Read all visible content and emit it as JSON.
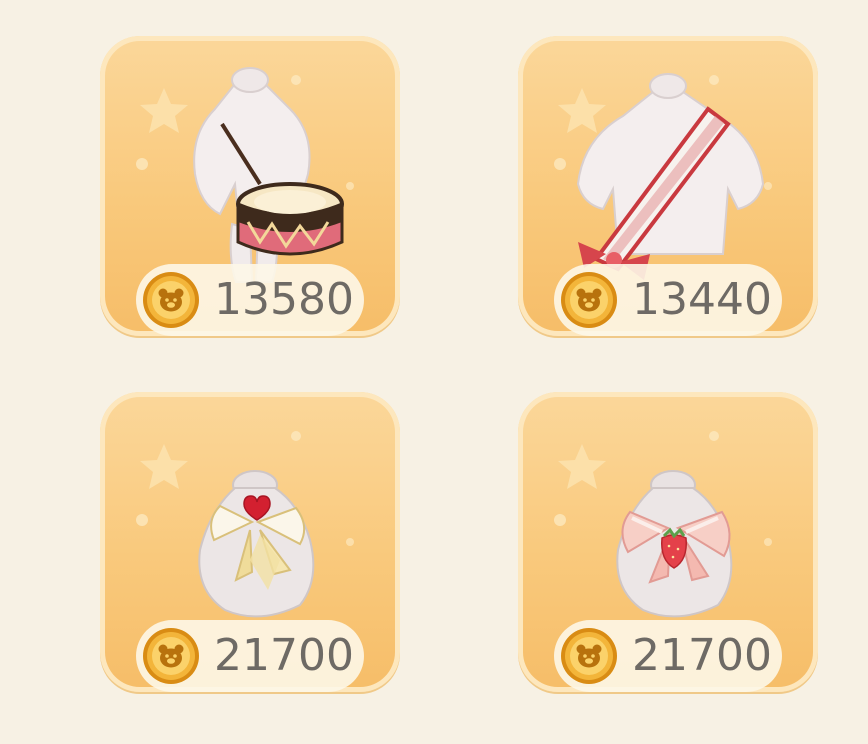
{
  "shop": {
    "items": [
      {
        "name": "drum-outfit",
        "price": "13580",
        "currency_icon": "bear-coin-icon"
      },
      {
        "name": "sash-outfit",
        "price": "13440",
        "currency_icon": "bear-coin-icon"
      },
      {
        "name": "cream-bow-top",
        "price": "21700",
        "currency_icon": "bear-coin-icon"
      },
      {
        "name": "strawberry-bow-top",
        "price": "21700",
        "currency_icon": "bear-coin-icon"
      }
    ]
  },
  "colors": {
    "background": "#f7f1e4",
    "card": "#f9c97c",
    "card_border": "#fde7bd",
    "coin": "#e8a21f",
    "price_text": "#6e6a65"
  }
}
